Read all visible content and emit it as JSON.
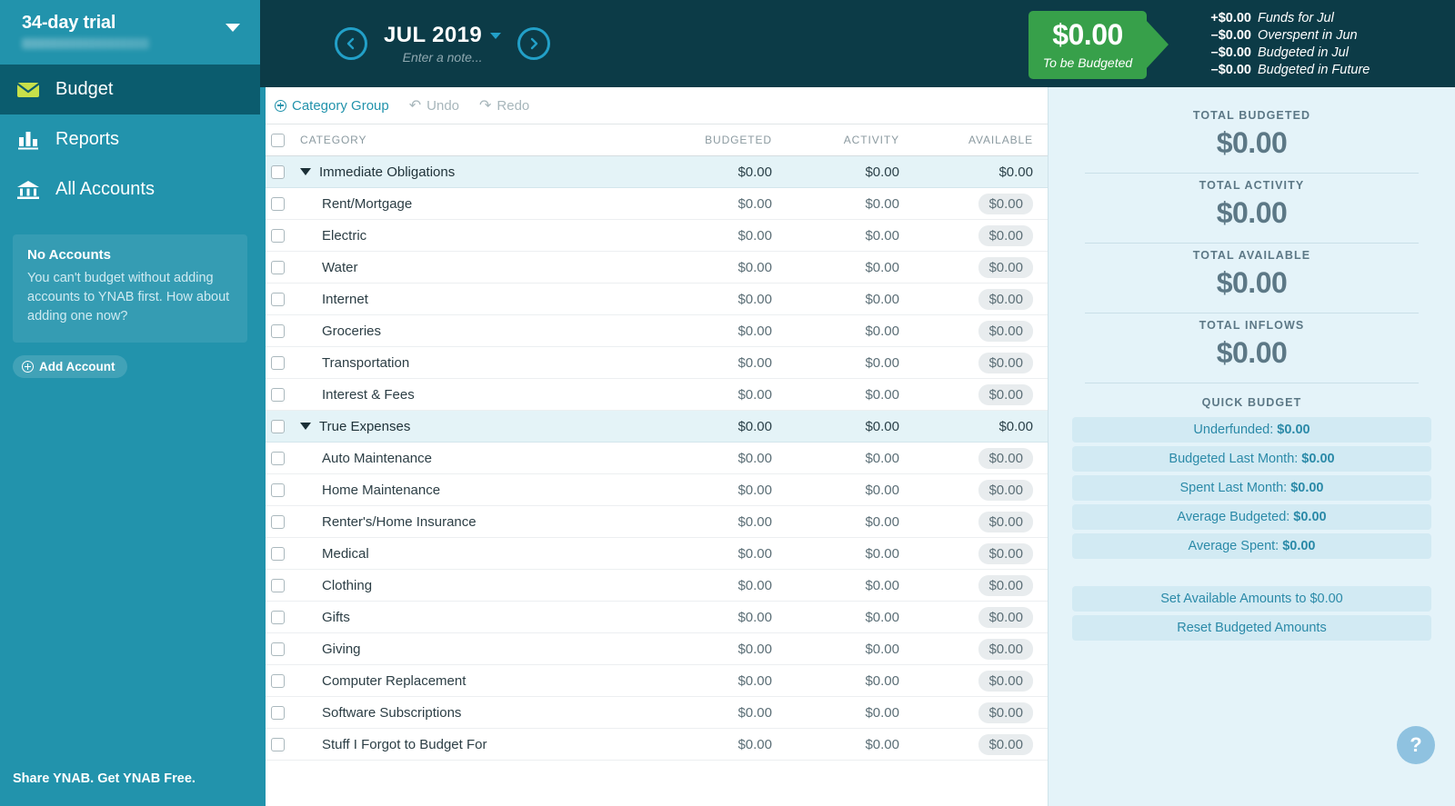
{
  "sidebar": {
    "budget_name": "34-day trial",
    "nav": [
      {
        "label": "Budget",
        "icon": "envelope-icon",
        "active": true
      },
      {
        "label": "Reports",
        "icon": "bar-chart-icon",
        "active": false
      },
      {
        "label": "All Accounts",
        "icon": "bank-icon",
        "active": false
      }
    ],
    "accounts_box": {
      "title": "No Accounts",
      "text": "You can't budget without adding accounts to YNAB first. How about adding one now?"
    },
    "add_account_label": "Add Account",
    "footer_label": "Share YNAB. Get YNAB Free."
  },
  "topbar": {
    "month": "JUL 2019",
    "note_placeholder": "Enter a note...",
    "prev_icon": "chevron-left-icon",
    "next_icon": "chevron-right-icon",
    "to_be_budgeted": {
      "amount": "$0.00",
      "label": "To be Budgeted",
      "color": "#37a04a"
    },
    "breakdown": [
      {
        "amount": "+$0.00",
        "label": "Funds for Jul"
      },
      {
        "amount": "–$0.00",
        "label": "Overspent in Jun"
      },
      {
        "amount": "–$0.00",
        "label": "Budgeted in Jul"
      },
      {
        "amount": "–$0.00",
        "label": "Budgeted in Future"
      }
    ]
  },
  "toolbar": {
    "category_group_label": "Category Group",
    "undo_label": "Undo",
    "redo_label": "Redo"
  },
  "grid": {
    "headers": {
      "category": "CATEGORY",
      "budgeted": "BUDGETED",
      "activity": "ACTIVITY",
      "available": "AVAILABLE"
    },
    "rows": [
      {
        "type": "group",
        "name": "Immediate Obligations",
        "budgeted": "$0.00",
        "activity": "$0.00",
        "available": "$0.00"
      },
      {
        "type": "category",
        "name": "Rent/Mortgage",
        "budgeted": "$0.00",
        "activity": "$0.00",
        "available": "$0.00"
      },
      {
        "type": "category",
        "name": "Electric",
        "budgeted": "$0.00",
        "activity": "$0.00",
        "available": "$0.00"
      },
      {
        "type": "category",
        "name": "Water",
        "budgeted": "$0.00",
        "activity": "$0.00",
        "available": "$0.00"
      },
      {
        "type": "category",
        "name": "Internet",
        "budgeted": "$0.00",
        "activity": "$0.00",
        "available": "$0.00"
      },
      {
        "type": "category",
        "name": "Groceries",
        "budgeted": "$0.00",
        "activity": "$0.00",
        "available": "$0.00"
      },
      {
        "type": "category",
        "name": "Transportation",
        "budgeted": "$0.00",
        "activity": "$0.00",
        "available": "$0.00"
      },
      {
        "type": "category",
        "name": "Interest & Fees",
        "budgeted": "$0.00",
        "activity": "$0.00",
        "available": "$0.00"
      },
      {
        "type": "group",
        "name": "True Expenses",
        "budgeted": "$0.00",
        "activity": "$0.00",
        "available": "$0.00"
      },
      {
        "type": "category",
        "name": "Auto Maintenance",
        "budgeted": "$0.00",
        "activity": "$0.00",
        "available": "$0.00"
      },
      {
        "type": "category",
        "name": "Home Maintenance",
        "budgeted": "$0.00",
        "activity": "$0.00",
        "available": "$0.00"
      },
      {
        "type": "category",
        "name": "Renter's/Home Insurance",
        "budgeted": "$0.00",
        "activity": "$0.00",
        "available": "$0.00"
      },
      {
        "type": "category",
        "name": "Medical",
        "budgeted": "$0.00",
        "activity": "$0.00",
        "available": "$0.00"
      },
      {
        "type": "category",
        "name": "Clothing",
        "budgeted": "$0.00",
        "activity": "$0.00",
        "available": "$0.00"
      },
      {
        "type": "category",
        "name": "Gifts",
        "budgeted": "$0.00",
        "activity": "$0.00",
        "available": "$0.00"
      },
      {
        "type": "category",
        "name": "Giving",
        "budgeted": "$0.00",
        "activity": "$0.00",
        "available": "$0.00"
      },
      {
        "type": "category",
        "name": "Computer Replacement",
        "budgeted": "$0.00",
        "activity": "$0.00",
        "available": "$0.00"
      },
      {
        "type": "category",
        "name": "Software Subscriptions",
        "budgeted": "$0.00",
        "activity": "$0.00",
        "available": "$0.00"
      },
      {
        "type": "category",
        "name": "Stuff I Forgot to Budget For",
        "budgeted": "$0.00",
        "activity": "$0.00",
        "available": "$0.00"
      }
    ]
  },
  "inspector": {
    "totals": [
      {
        "label": "TOTAL BUDGETED",
        "value": "$0.00"
      },
      {
        "label": "TOTAL ACTIVITY",
        "value": "$0.00"
      },
      {
        "label": "TOTAL AVAILABLE",
        "value": "$0.00"
      },
      {
        "label": "TOTAL INFLOWS",
        "value": "$0.00"
      }
    ],
    "quick_budget_title": "QUICK BUDGET",
    "quick_budget": [
      {
        "label": "Underfunded:",
        "value": "$0.00"
      },
      {
        "label": "Budgeted Last Month:",
        "value": "$0.00"
      },
      {
        "label": "Spent Last Month:",
        "value": "$0.00"
      },
      {
        "label": "Average Budgeted:",
        "value": "$0.00"
      },
      {
        "label": "Average Spent:",
        "value": "$0.00"
      }
    ],
    "actions": [
      {
        "label": "Set Available Amounts to $0.00"
      },
      {
        "label": "Reset Budgeted Amounts"
      }
    ],
    "help_icon": "question-mark-icon"
  }
}
